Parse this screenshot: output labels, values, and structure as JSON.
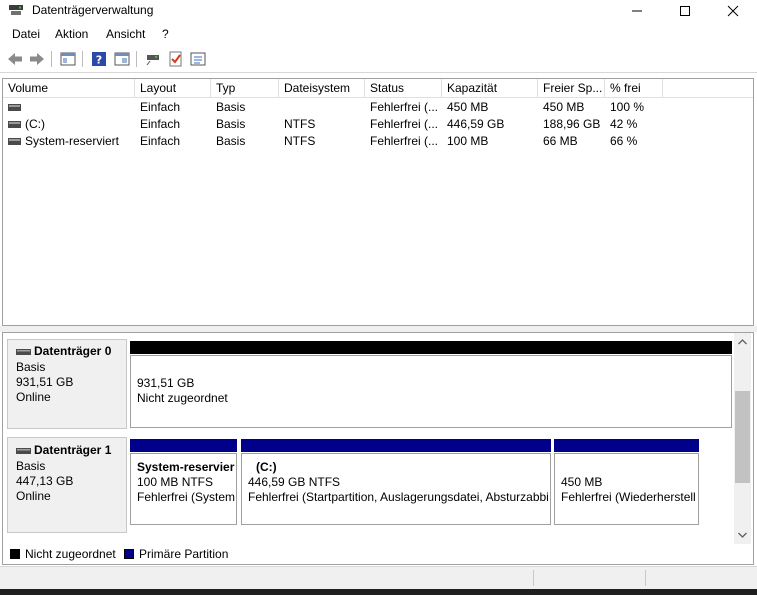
{
  "window": {
    "title": "Datenträgerverwaltung",
    "controls": [
      "minimize",
      "maximize",
      "close"
    ]
  },
  "menu": {
    "items": [
      "Datei",
      "Aktion",
      "Ansicht",
      "?"
    ]
  },
  "toolbar": {
    "icons": [
      "back-icon",
      "forward-icon",
      "console-view-icon",
      "help-icon",
      "properties-icon",
      "drive-link-icon",
      "check-icon",
      "settings-list-icon"
    ]
  },
  "volume_table": {
    "columns": [
      "Volume",
      "Layout",
      "Typ",
      "Dateisystem",
      "Status",
      "Kapazität",
      "Freier Sp...",
      "% frei"
    ],
    "rows": [
      {
        "volume": "",
        "layout": "Einfach",
        "typ": "Basis",
        "dateisystem": "",
        "status": "Fehlerfrei (...",
        "kapazitaet": "450 MB",
        "frei": "450 MB",
        "prozent": "100 %"
      },
      {
        "volume": "(C:)",
        "layout": "Einfach",
        "typ": "Basis",
        "dateisystem": "NTFS",
        "status": "Fehlerfrei (...",
        "kapazitaet": "446,59 GB",
        "frei": "188,96 GB",
        "prozent": "42 %"
      },
      {
        "volume": "System-reserviert",
        "layout": "Einfach",
        "typ": "Basis",
        "dateisystem": "NTFS",
        "status": "Fehlerfrei (...",
        "kapazitaet": "100 MB",
        "frei": "66 MB",
        "prozent": "66 %"
      }
    ]
  },
  "disks": [
    {
      "name": "Datenträger 0",
      "type": "Basis",
      "size": "931,51 GB",
      "state": "Online",
      "partitions": [
        {
          "kind": "unallocated",
          "line1": "931,51 GB",
          "line2": "Nicht zugeordnet"
        }
      ]
    },
    {
      "name": "Datenträger 1",
      "type": "Basis",
      "size": "447,13 GB",
      "state": "Online",
      "partitions": [
        {
          "kind": "primary",
          "title": "System-reservier",
          "line1": "100 MB NTFS",
          "line2": "Fehlerfrei (System,"
        },
        {
          "kind": "primary",
          "title": "(C:)",
          "line1": "446,59 GB NTFS",
          "line2": "Fehlerfrei (Startpartition, Auslagerungsdatei, Absturzabbi"
        },
        {
          "kind": "primary",
          "title": "",
          "line1": "450 MB",
          "line2": "Fehlerfrei (Wiederherstell"
        }
      ]
    }
  ],
  "legend": {
    "items": [
      {
        "label": "Nicht zugeordnet",
        "color": "#000000"
      },
      {
        "label": "Primäre Partition",
        "color": "#00008b"
      }
    ]
  },
  "colors": {
    "unallocated": "#000000",
    "primary": "#00008b"
  }
}
